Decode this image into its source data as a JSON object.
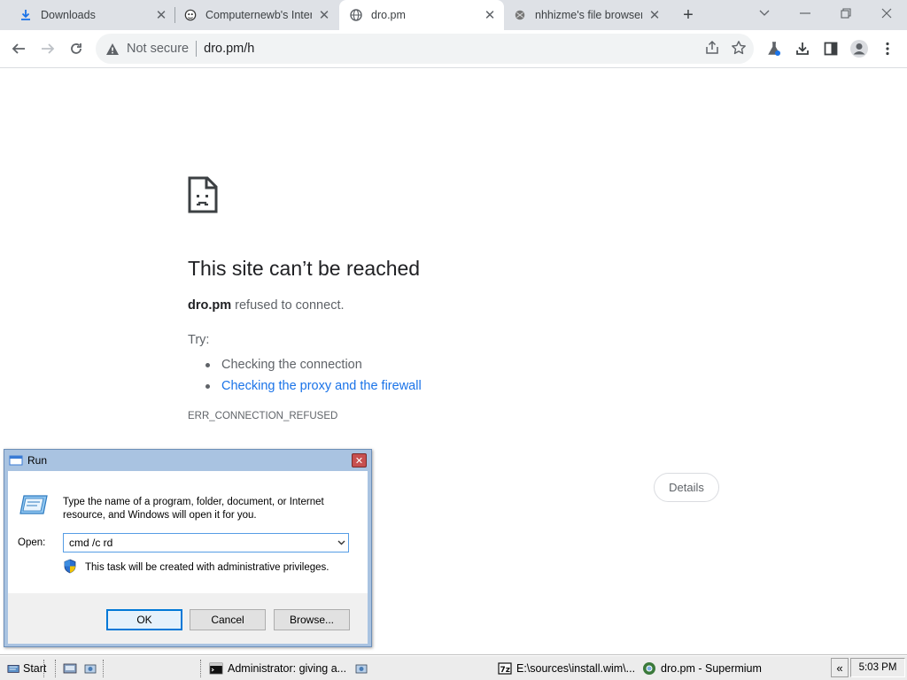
{
  "tabs": [
    {
      "title": "Downloads",
      "icon": "download-icon"
    },
    {
      "title": "Computernewb's Internet",
      "icon": "computernewb-icon"
    },
    {
      "title": "dro.pm",
      "icon": "globe-icon",
      "active": true
    },
    {
      "title": "nhhizme's file browser",
      "icon": "file-browser-icon"
    }
  ],
  "omnibox": {
    "security_label": "Not secure",
    "url": "dro.pm/h"
  },
  "error_page": {
    "title": "This site can’t be reached",
    "host": "dro.pm",
    "message_rest": " refused to connect.",
    "try_label": "Try:",
    "suggestions": [
      {
        "text": "Checking the connection"
      },
      {
        "text": "Checking the proxy and the firewall"
      }
    ],
    "error_code": "ERR_CONNECTION_REFUSED",
    "details_label": "Details"
  },
  "run_dialog": {
    "title": "Run",
    "description": "Type the name of a program, folder, document, or Internet resource, and Windows will open it for you.",
    "open_label": "Open:",
    "input_value": "cmd /c rd",
    "admin_note": "This task will be created with administrative privileges.",
    "ok_label": "OK",
    "cancel_label": "Cancel",
    "browse_label": "Browse..."
  },
  "taskbar": {
    "start_label": "Start",
    "items": [
      {
        "label": "Administrator:  giving a..."
      },
      {
        "label": "E:\\sources\\install.wim\\..."
      },
      {
        "label": "dro.pm - Supermium"
      }
    ],
    "chevron": "«",
    "clock": "5:03 PM"
  },
  "colors": {
    "link": "#1a73e8",
    "tabstrip": "#dee1e6",
    "dialog_frame": "#a9c3e1"
  }
}
